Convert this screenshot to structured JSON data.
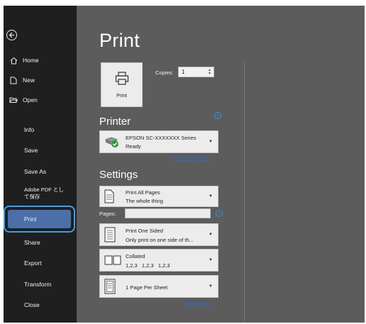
{
  "sidebar": {
    "items": [
      {
        "label": "Home",
        "icon": "home-icon"
      },
      {
        "label": "New",
        "icon": "new-document-icon"
      },
      {
        "label": "Open",
        "icon": "folder-open-icon"
      },
      {
        "label": "Info"
      },
      {
        "label": "Save"
      },
      {
        "label": "Save As"
      },
      {
        "label": "Adobe PDF とし\nて保存"
      },
      {
        "label": "Print"
      },
      {
        "label": "Share"
      },
      {
        "label": "Export"
      },
      {
        "label": "Transform"
      },
      {
        "label": "Close"
      }
    ]
  },
  "main": {
    "title": "Print",
    "print_button_label": "Print",
    "copies_label": "Copies:",
    "copies_value": "1",
    "printer_heading": "Printer",
    "printer_name": "EPSON SC-XXXXXXX Series",
    "printer_status": "Ready",
    "printer_properties": "Printer Properties",
    "settings_heading": "Settings",
    "settings": [
      {
        "line1": "Print All Pages",
        "line2": "The whole thing",
        "icon": "pages-icon"
      },
      {
        "line1": "Print One Sided",
        "line2": "Only print on one side of th...",
        "icon": "one-sided-icon"
      },
      {
        "line1": "Collated",
        "line2": "1,2,3   1,2,3   1,2,3",
        "icon": "collated-icon"
      },
      {
        "line1": "1 Page Per Sheet",
        "line2": "",
        "icon": "page-per-sheet-icon"
      }
    ],
    "pages_label": "Pages:",
    "page_setup": "Page Setup"
  },
  "colors": {
    "sidebar_bg": "#1f1f1f",
    "main_bg": "#5c5c5c",
    "active_item": "#4b6fa8",
    "highlight_ring": "#3aa0ef",
    "link": "#2f6bbf"
  }
}
